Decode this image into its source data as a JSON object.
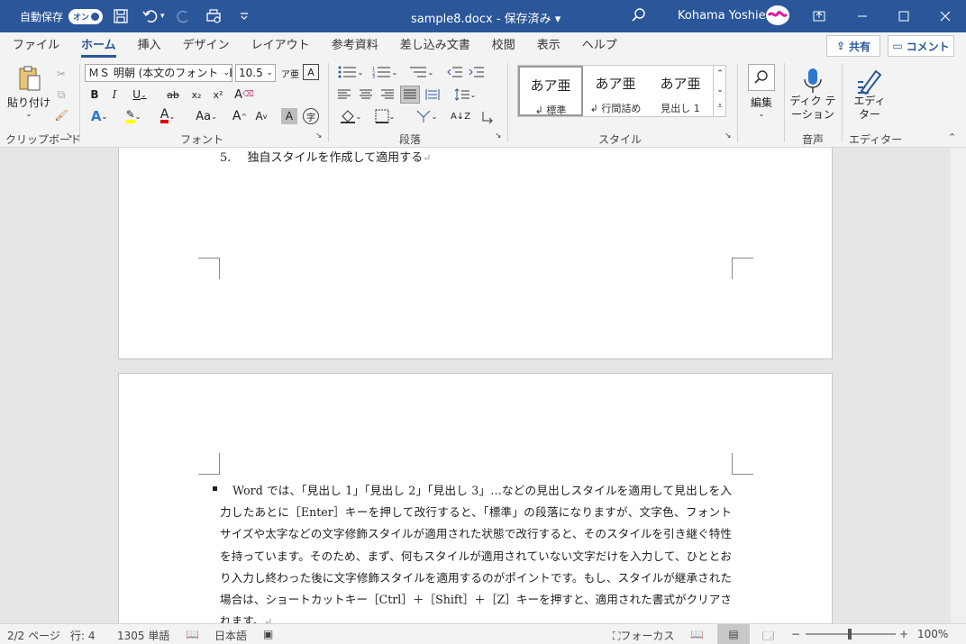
{
  "titlebar": {
    "autosave_label": "自動保存",
    "autosave_state": "オン",
    "doc_title": "sample8.docx - 保存済み",
    "user": "Kohama Yoshie"
  },
  "tabs": [
    "ファイル",
    "ホーム",
    "挿入",
    "デザイン",
    "レイアウト",
    "参考資料",
    "差し込み文書",
    "校閲",
    "表示",
    "ヘルプ"
  ],
  "actions": {
    "share": "共有",
    "comment": "コメント"
  },
  "ribbon": {
    "clipboard": {
      "paste": "貼り付け",
      "label": "クリップボード"
    },
    "font": {
      "name": "ＭＳ 明朝 (本文のフォント - E",
      "size": "10.5",
      "label": "フォント"
    },
    "paragraph": {
      "label": "段落"
    },
    "styles": {
      "label": "スタイル",
      "items": [
        {
          "sample": "あア亜",
          "name": "標準"
        },
        {
          "sample": "あア亜",
          "name": "行間詰め"
        },
        {
          "sample": "あア亜",
          "name": "見出し 1"
        }
      ]
    },
    "editing": {
      "label": "編集"
    },
    "dictation": {
      "label": "ディク テーション",
      "group": "音声"
    },
    "editor": {
      "label": "エディ ター",
      "group": "エディター"
    }
  },
  "document": {
    "list_item_number": "5.",
    "list_item_text": "独自スタイルを作成して適用する",
    "body": "Word では、「見出し 1」「見出し 2」「見出し 3」…などの見出しスタイルを適用して見出しを入力したあとに［Enter］キーを押して改行すると、「標準」の段落になりますが、文字色、フォントサイズや太字などの文字修飾スタイルが適用された状態で改行すると、そのスタイルを引き継ぐ特性を持っています。そのため、まず、何もスタイルが適用されていない文字だけを入力して、ひととおり入力し終わった後に文字修飾スタイルを適用するのがポイントです。もし、スタイルが継承された場合は、ショートカットキー［Ctrl］＋［Shift］＋［Z］キーを押すと、適用された書式がクリアされます。"
  },
  "status": {
    "page": "2/2 ページ",
    "line": "行: 4",
    "words": "1305 単語",
    "language": "日本語",
    "focus": "フォーカス",
    "zoom": "100%"
  },
  "colors": {
    "brand": "#2b579a",
    "highlight": "#ffff00",
    "font_color": "#e00000"
  }
}
